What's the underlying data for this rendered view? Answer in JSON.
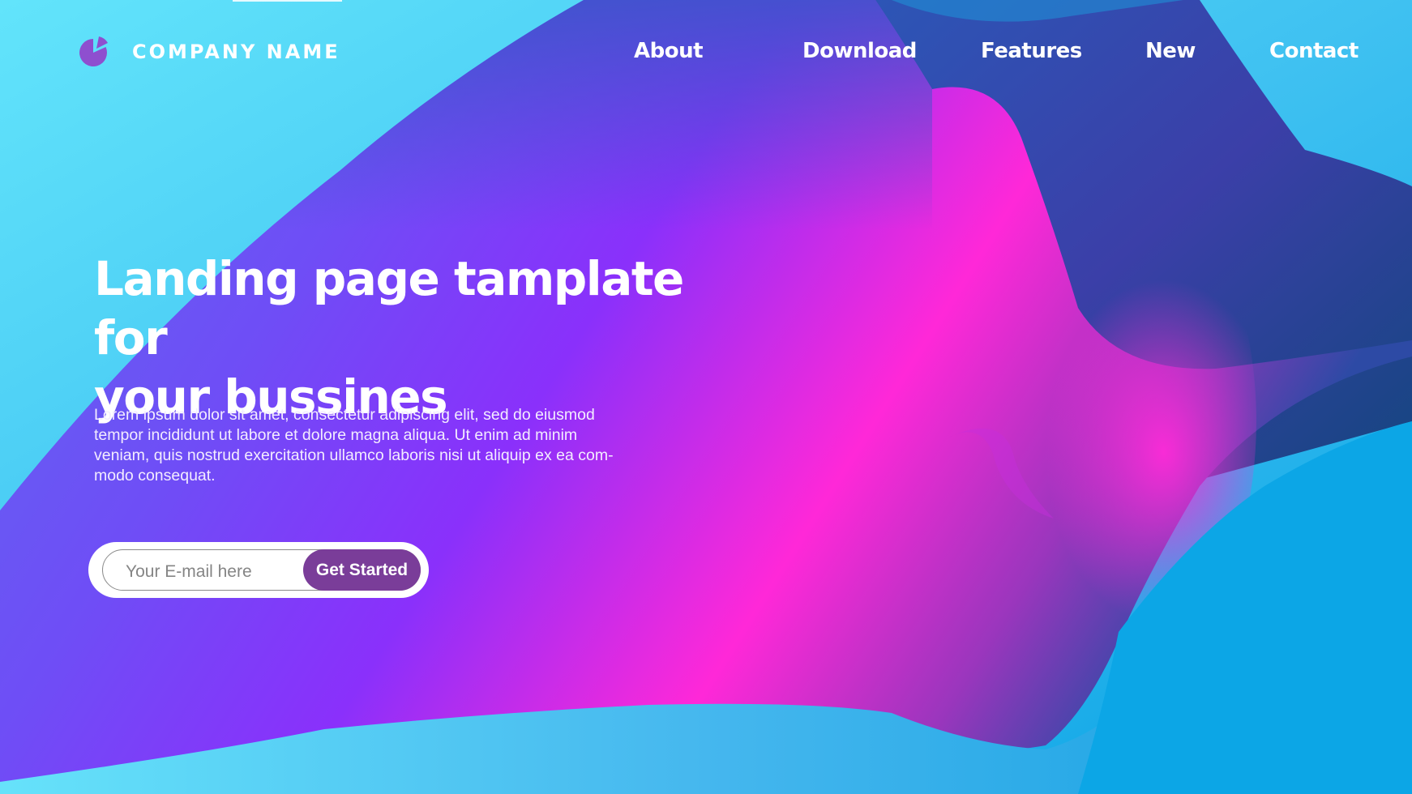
{
  "brand": {
    "name": "COMPANY NAME",
    "logo_icon": "pie-chart-icon",
    "logo_color": "#8e4fcf"
  },
  "nav": {
    "items": [
      {
        "label": "About"
      },
      {
        "label": "Download"
      },
      {
        "label": "Features"
      },
      {
        "label": "New"
      },
      {
        "label": "Contact"
      }
    ]
  },
  "hero": {
    "title_line1": "Landing page tamplate for",
    "title_line2": "your bussines",
    "body": "Lorem ipsum dolor sit amet, consectetur adipiscing elit, sed do eiusmod tempor incididunt ut labore et dolore magna aliqua. Ut enim ad minim veniam, quis nostrud exercitation ullamco laboris nisi ut aliquip ex ea com-modo consequat.",
    "body_lines": [
      "Lorem ipsum dolor sit amet, consectetur adipiscing elit, sed do eiusmod",
      "tempor incididunt ut labore et dolore magna aliqua. Ut enim ad minim",
      "veniam, quis nostrud exercitation ullamco laboris nisi ut aliquip ex ea com-",
      "modo consequat."
    ]
  },
  "signup": {
    "email_placeholder": "Your E-mail here",
    "email_value": "",
    "button_label": "Get Started",
    "button_color": "#7a3d99"
  },
  "colors": {
    "sky": "#4fd3f7",
    "violet": "#8434fb",
    "magenta": "#ff27d6",
    "navy": "#1c4a9a"
  }
}
